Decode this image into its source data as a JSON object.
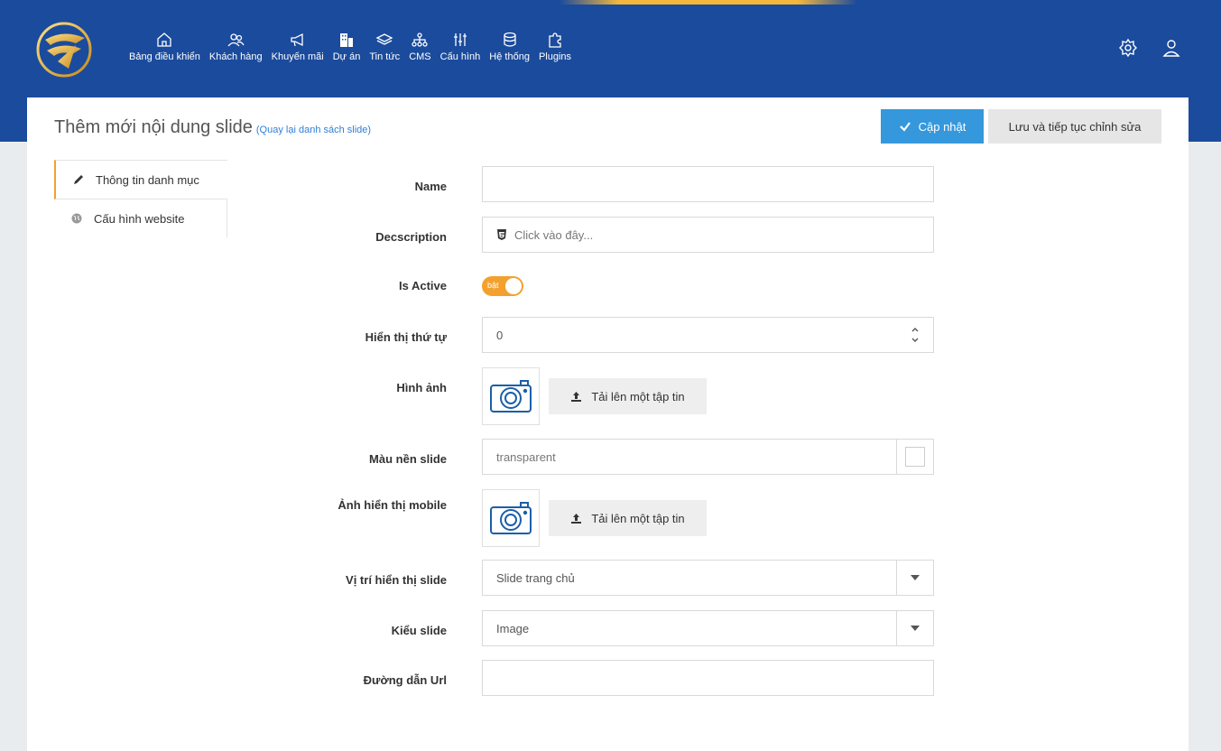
{
  "nav": {
    "items": [
      {
        "label": "Bảng điều khiển",
        "icon": "home-icon"
      },
      {
        "label": "Khách hàng",
        "icon": "users-icon"
      },
      {
        "label": "Khuyến mãi",
        "icon": "megaphone-icon"
      },
      {
        "label": "Dự án",
        "icon": "building-icon"
      },
      {
        "label": "Tin tức",
        "icon": "layers-icon"
      },
      {
        "label": "CMS",
        "icon": "sitemap-icon"
      },
      {
        "label": "Cấu hình",
        "icon": "sliders-icon"
      },
      {
        "label": "Hệ thống",
        "icon": "database-icon"
      },
      {
        "label": "Plugins",
        "icon": "puzzle-icon"
      }
    ],
    "right_icons": [
      "gear-icon",
      "user-icon"
    ]
  },
  "header": {
    "title": "Thêm mới nội dung slide",
    "back_link": "(Quay lại danh sách slide)",
    "save_label": "Cập nhật",
    "save_continue_label": "Lưu và tiếp tục chỉnh sửa"
  },
  "tabs": [
    {
      "label": "Thông tin danh mục",
      "icon": "pencil-icon",
      "active": true
    },
    {
      "label": "Cấu hình website",
      "icon": "globe-icon",
      "active": false
    }
  ],
  "form": {
    "name": {
      "label": "Name",
      "value": ""
    },
    "description": {
      "label": "Decscription",
      "placeholder": "Click vào đây..."
    },
    "is_active": {
      "label": "Is Active",
      "toggle_text": "bật",
      "on": true
    },
    "order": {
      "label": "Hiển thị thứ tự",
      "value": "0"
    },
    "image": {
      "label": "Hình ảnh",
      "upload_label": "Tải lên một tập tin"
    },
    "bg_color": {
      "label": "Màu nền slide",
      "value": "transparent"
    },
    "mobile_image": {
      "label": "Ảnh hiển thị mobile",
      "upload_label": "Tải lên một tập tin"
    },
    "position": {
      "label": "Vị trí hiển thị slide",
      "value": "Slide trang chủ"
    },
    "type": {
      "label": "Kiểu slide",
      "value": "Image"
    },
    "url": {
      "label": "Đường dẫn Url",
      "value": ""
    }
  },
  "colors": {
    "topbar": "#1b4b9c",
    "primary_button": "#3598dc",
    "accent": "#f2a12e"
  }
}
